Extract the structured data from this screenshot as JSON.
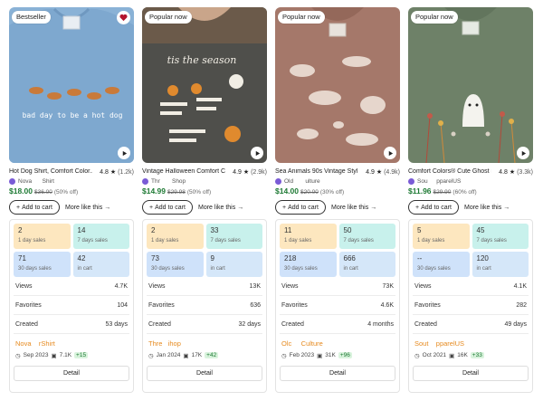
{
  "colors": {
    "price": "#1e7a34",
    "shop": "#e68a1f",
    "sales1": "#fde7bf",
    "sales7": "#c8f1ec",
    "sales30": "#cfe2fa",
    "incart": "#d5e7f9"
  },
  "labels": {
    "add_to_cart": "Add to cart",
    "more_like_this": "More like this",
    "day1": "1 day sales",
    "day7": "7 days sales",
    "day30": "30 days sales",
    "in_cart": "in cart",
    "views": "Views",
    "favorites": "Favorites",
    "created": "Created",
    "detail": "Detail"
  },
  "products": [
    {
      "badge": "Bestseller",
      "has_favorite": true,
      "art_text": "bad day to be a hot dog",
      "title": "Hot Dog Shirt, Comfort Color...",
      "rating": "4.8",
      "reviews": "(1.2k)",
      "shop_short": "Nova",
      "shop_short2": "Shirt",
      "price": "$18.00",
      "old_price": "$36.00",
      "discount": "(50% off)",
      "sales_1d": "2",
      "sales_7d": "14",
      "sales_30d": "71",
      "in_cart": "42",
      "views": "4.7K",
      "favorites": "104",
      "created": "53 days",
      "shop_name_a": "Nova",
      "shop_name_b": "rShirt",
      "shop_date": "Sep 2023",
      "shop_sales": "7.1K",
      "shop_new": "+15"
    },
    {
      "badge": "Popular now",
      "has_favorite": false,
      "art_text": "tis the season",
      "title": "Vintage Halloween Comfort C...",
      "rating": "4.9",
      "reviews": "(2.9k)",
      "shop_short": "Thr",
      "shop_short2": "Shop",
      "price": "$14.99",
      "old_price": "$29.98",
      "discount": "(50% off)",
      "sales_1d": "2",
      "sales_7d": "33",
      "sales_30d": "73",
      "in_cart": "9",
      "views": "13K",
      "favorites": "636",
      "created": "32 days",
      "shop_name_a": "Thre",
      "shop_name_b": "ihop",
      "shop_date": "Jan 2024",
      "shop_sales": "17K",
      "shop_new": "+42"
    },
    {
      "badge": "Popular now",
      "has_favorite": false,
      "art_text": "",
      "title": "Sea Animals 90s Vintage Styl...",
      "rating": "4.9",
      "reviews": "(4.9k)",
      "shop_short": "Old",
      "shop_short2": "ulture",
      "price": "$14.00",
      "old_price": "$20.00",
      "discount": "(30% off)",
      "sales_1d": "11",
      "sales_7d": "50",
      "sales_30d": "218",
      "in_cart": "666",
      "views": "73K",
      "favorites": "4.6K",
      "created": "4 months",
      "shop_name_a": "Olc",
      "shop_name_b": "Culture",
      "shop_date": "Feb 2023",
      "shop_sales": "31K",
      "shop_new": "+96"
    },
    {
      "badge": "Popular now",
      "has_favorite": false,
      "art_text": "",
      "title": "Comfort Colors® Cute Ghost i...",
      "rating": "4.8",
      "reviews": "(3.3k)",
      "shop_short": "Sou",
      "shop_short2": "pparelUS",
      "price": "$11.96",
      "old_price": "$29.90",
      "discount": "(60% off)",
      "sales_1d": "5",
      "sales_7d": "45",
      "sales_30d": "--",
      "in_cart": "120",
      "views": "4.1K",
      "favorites": "282",
      "created": "49 days",
      "shop_name_a": "Sout",
      "shop_name_b": "pparelUS",
      "shop_date": "Oct 2021",
      "shop_sales": "16K",
      "shop_new": "+33"
    }
  ]
}
